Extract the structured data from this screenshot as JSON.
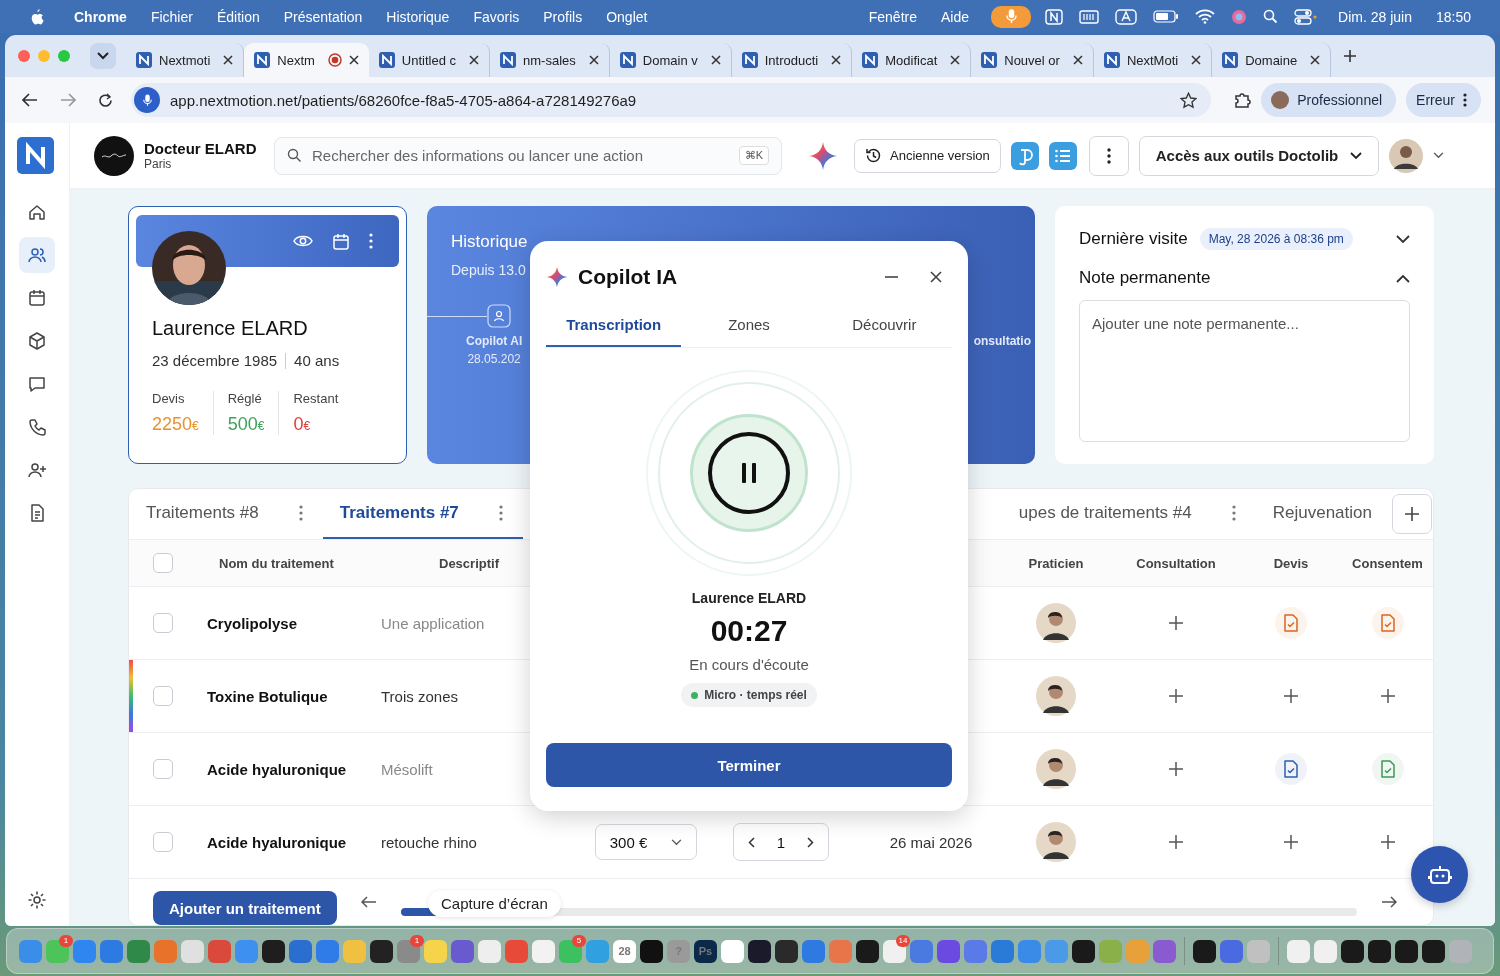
{
  "menubar": {
    "app": "Chrome",
    "items": [
      "Fichier",
      "Édition",
      "Présentation",
      "Historique",
      "Favoris",
      "Profils",
      "Onglet"
    ],
    "right_items": [
      "Fenêtre",
      "Aide"
    ],
    "date": "Dim. 28 juin",
    "time": "18:50"
  },
  "browser": {
    "tabs": [
      {
        "title": "Nextmoti",
        "selected": false,
        "recording": false
      },
      {
        "title": "Nextm",
        "selected": true,
        "recording": true
      },
      {
        "title": "Untitled c",
        "selected": false,
        "recording": false
      },
      {
        "title": "nm-sales",
        "selected": false,
        "recording": false
      },
      {
        "title": "Domain v",
        "selected": false,
        "recording": false
      },
      {
        "title": "Introducti",
        "selected": false,
        "recording": false
      },
      {
        "title": "Modificat",
        "selected": false,
        "recording": false
      },
      {
        "title": "Nouvel or",
        "selected": false,
        "recording": false
      },
      {
        "title": "NextMoti",
        "selected": false,
        "recording": false
      },
      {
        "title": "Domaine",
        "selected": false,
        "recording": false
      }
    ],
    "url": "app.nextmotion.net/patients/68260fce-f8a5-4705-a864-a728149276a9",
    "profile": "Professionnel",
    "error": "Erreur"
  },
  "sidebar": {
    "items": [
      {
        "selected": false
      },
      {
        "selected": true
      },
      {
        "selected": false
      },
      {
        "selected": false
      },
      {
        "selected": false
      },
      {
        "selected": false
      },
      {
        "selected": false
      },
      {
        "selected": false
      }
    ]
  },
  "header": {
    "doctor": "Docteur ELARD",
    "city": "Paris",
    "search_placeholder": "Rechercher des informations ou lancer une action",
    "shortcut": "⌘K",
    "old_version": "Ancienne version",
    "doctolib": "Accès aux outils Doctolib"
  },
  "patient": {
    "name": "Laurence ELARD",
    "birthdate": "23 décembre 1985",
    "age": "40 ans",
    "stats": [
      {
        "label": "Devis",
        "value": "2250",
        "currency": "€",
        "color": "#e8912d"
      },
      {
        "label": "Réglé",
        "value": "500",
        "currency": "€",
        "color": "#3fa45b"
      },
      {
        "label": "Restant",
        "value": "0",
        "currency": "€",
        "color": "#e0413a"
      }
    ]
  },
  "history": {
    "title": "Historique",
    "since": "Depuis 13.0",
    "event": "Copilot AI",
    "event_date": "28.05.202",
    "next_event": "onsultatio"
  },
  "side_panel": {
    "last_visit": "Dernière visite",
    "last_visit_date": "May, 28 2026 à 08:36 pm",
    "note_title": "Note permanente",
    "note_expanded": true,
    "note_placeholder": "Ajouter une note permanente..."
  },
  "treatments": {
    "tabs": [
      {
        "label": "Traitements #8",
        "selected": false,
        "menu": true
      },
      {
        "label": "Traitements #7",
        "selected": true,
        "menu": true
      },
      {
        "label": "upes de traitements #4",
        "selected": false,
        "menu": true
      },
      {
        "label": "Rejuvenation",
        "selected": false,
        "menu": false
      }
    ],
    "select_all_checked": false,
    "columns": [
      "Nom du traitement",
      "Descriptif",
      "Praticien",
      "Consultation",
      "Devis",
      "Consentem"
    ],
    "rows": [
      {
        "checked": false,
        "flagged": false,
        "name": "Cryolipolyse",
        "description": "Une application",
        "description_muted": true,
        "consultation": {
          "kind": "add"
        },
        "devis": {
          "kind": "doc",
          "color": "#d9661f"
        },
        "consent": {
          "kind": "doc",
          "color": "#d9661f"
        }
      },
      {
        "checked": false,
        "flagged": true,
        "name": "Toxine Botulique",
        "description": "Trois zones",
        "description_muted": false,
        "consultation": {
          "kind": "add"
        },
        "devis": {
          "kind": "add"
        },
        "consent": {
          "kind": "add"
        }
      },
      {
        "checked": false,
        "flagged": false,
        "name": "Acide hyaluronique",
        "description": "Mésolift",
        "description_muted": true,
        "consultation": {
          "kind": "add"
        },
        "devis": {
          "kind": "doc",
          "color": "#2f5fb0"
        },
        "consent": {
          "kind": "doc",
          "color": "#3a9a5a"
        }
      },
      {
        "checked": false,
        "flagged": false,
        "name": "Acide hyaluronique",
        "description": "retouche rhino",
        "description_muted": false,
        "price": "300 €",
        "quantity": "1",
        "date": "26 mai 2026",
        "consultation": {
          "kind": "add"
        },
        "devis": {
          "kind": "add"
        },
        "consent": {
          "kind": "add"
        }
      }
    ],
    "add_button": "Ajouter un traitement"
  },
  "tooltip": "Capture d’écran",
  "copilot": {
    "title": "Copilot IA",
    "tabs": [
      {
        "label": "Transcription",
        "selected": true
      },
      {
        "label": "Zones",
        "selected": false
      },
      {
        "label": "Découvrir",
        "selected": false
      }
    ],
    "patient": "Laurence ELARD",
    "timer": "00:27",
    "status": "En cours d'écoute",
    "source": "Micro · temps réel",
    "finish": "Terminer"
  },
  "dock": [
    {
      "color": "#3a8ee8"
    },
    {
      "color": "#4cc45a",
      "badge": "1"
    },
    {
      "color": "#2f86f0"
    },
    {
      "color": "#2d7be0"
    },
    {
      "color": "#2f8a4a"
    },
    {
      "color": "#e8722a"
    },
    {
      "color": "#e0e0e0"
    },
    {
      "color": "#d94a3a"
    },
    {
      "color": "#3d8ff0"
    },
    {
      "color": "#1e1e1e"
    },
    {
      "color": "#2a6fd0"
    },
    {
      "color": "#2f7be8"
    },
    {
      "color": "#f0c040"
    },
    {
      "color": "#222222"
    },
    {
      "color": "#8a8a8a",
      "badge": "1"
    },
    {
      "color": "#f5d34a"
    },
    {
      "color": "#6a5ad0"
    },
    {
      "color": "#eeeeee"
    },
    {
      "color": "#e84a3a"
    },
    {
      "color": "#f2f2f2"
    },
    {
      "color": "#3cc060",
      "badge": "5"
    },
    {
      "color": "#30a0e0"
    },
    {
      "color": "#ffffff",
      "glyph": "28"
    },
    {
      "color": "#111111"
    },
    {
      "color": "#9a9a9a",
      "glyph": "?"
    },
    {
      "color": "#0b2a4a",
      "glyph": "Ps"
    },
    {
      "color": "#ffffff"
    },
    {
      "color": "#1a1a2a"
    },
    {
      "color": "#2a2a2a"
    },
    {
      "color": "#2f7ae0"
    },
    {
      "color": "#e8744a"
    },
    {
      "color": "#1a1a1a"
    },
    {
      "color": "#f0f0f0",
      "badge": "14"
    },
    {
      "color": "#4a7ae0"
    },
    {
      "color": "#6a4ae0"
    },
    {
      "color": "#5a7ae8"
    },
    {
      "color": "#2a7ad8"
    },
    {
      "color": "#3a8ae8"
    },
    {
      "color": "#4a9ae8"
    },
    {
      "color": "#1a1a1a"
    },
    {
      "color": "#8ab04a"
    },
    {
      "color": "#e8a03a"
    },
    {
      "color": "#8a5ad0"
    },
    {
      "color": "#1a1a1a"
    },
    {
      "color": "#4a6ae0"
    },
    {
      "color": "#c0c0c0"
    },
    {
      "color": "#f0f0f0"
    },
    {
      "color": "#f0f0f0"
    },
    {
      "color": "#1a1a1a"
    },
    {
      "color": "#1a1a1a"
    },
    {
      "color": "#1a1a1a"
    },
    {
      "color": "#1a1a1a"
    },
    {
      "color": "#b0b4b8"
    }
  ]
}
